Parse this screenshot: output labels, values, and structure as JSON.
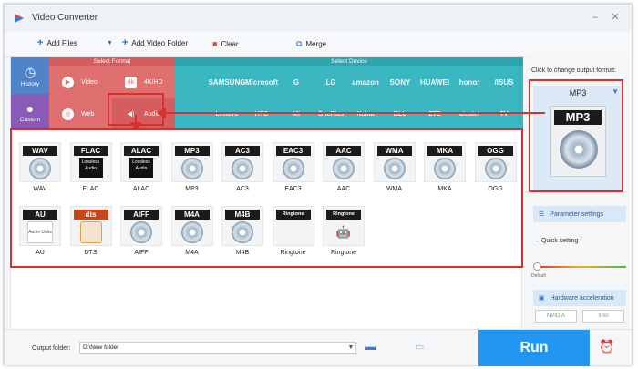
{
  "app": {
    "title": "Video Converter"
  },
  "toolbar": {
    "add_files": "Add Files",
    "add_video_folder": "Add Video Folder",
    "clear": "Clear",
    "merge": "Merge"
  },
  "categories": {
    "history": "History",
    "custom": "Custom"
  },
  "select_format": {
    "header": "Select Format",
    "video": "Video",
    "k4hd": "4K/HD",
    "web": "Web",
    "audio": "Audio"
  },
  "select_device": {
    "header": "Select Device",
    "row1": [
      "",
      "SAMSUNG",
      "Microsoft",
      "G",
      "LG",
      "amazon",
      "SONY",
      "HUAWEI",
      "honor",
      "/ISUS"
    ],
    "row2": [
      "",
      "Lenovo",
      "HTC",
      "MI",
      "OnePlus",
      "Nokia",
      "BLU",
      "ZTE",
      "alcatel",
      "TV"
    ]
  },
  "formats": [
    {
      "tag": "WAV",
      "name": "WAV",
      "type": "disc"
    },
    {
      "tag": "FLAC",
      "name": "FLAC",
      "type": "lossless"
    },
    {
      "tag": "ALAC",
      "name": "ALAC",
      "type": "lossless"
    },
    {
      "tag": "MP3",
      "name": "MP3",
      "type": "disc"
    },
    {
      "tag": "AC3",
      "name": "AC3",
      "type": "disc"
    },
    {
      "tag": "EAC3",
      "name": "EAC3",
      "type": "disc"
    },
    {
      "tag": "AAC",
      "name": "AAC",
      "type": "disc"
    },
    {
      "tag": "WMA",
      "name": "WMA",
      "type": "disc"
    },
    {
      "tag": "MKA",
      "name": "MKA",
      "type": "disc"
    },
    {
      "tag": "OGG",
      "name": "OGG",
      "type": "disc"
    },
    {
      "tag": "AU",
      "name": "AU",
      "type": "au"
    },
    {
      "tag": "dts",
      "name": "DTS",
      "type": "dts"
    },
    {
      "tag": "AIFF",
      "name": "AIFF",
      "type": "disc"
    },
    {
      "tag": "M4A",
      "name": "M4A",
      "type": "disc"
    },
    {
      "tag": "M4B",
      "name": "M4B",
      "type": "disc"
    },
    {
      "tag": "Ringtone",
      "name": "Ringtone",
      "type": "apple"
    },
    {
      "tag": "Ringtone",
      "name": "Ringtone",
      "type": "android"
    }
  ],
  "lossless_text": "Lossless Audio",
  "au_text": "Audio Units",
  "right": {
    "label": "Click to change output format:",
    "format": "MP3",
    "format_tag": "MP3",
    "parameter_settings": "Parameter settings",
    "quick_setting": "Quick setting",
    "default": "Default",
    "hardware_acceleration": "Hardware acceleration",
    "nvidia": "NVIDIA",
    "intel": "Intel"
  },
  "bottom": {
    "output_folder_label": "Output folder:",
    "output_folder_value": "D:\\New folder",
    "run": "Run"
  },
  "colors": {
    "highlight": "#d9302d",
    "run": "#2196f3",
    "format_bg": "#e07070",
    "device_bg": "#3ab7c0"
  }
}
